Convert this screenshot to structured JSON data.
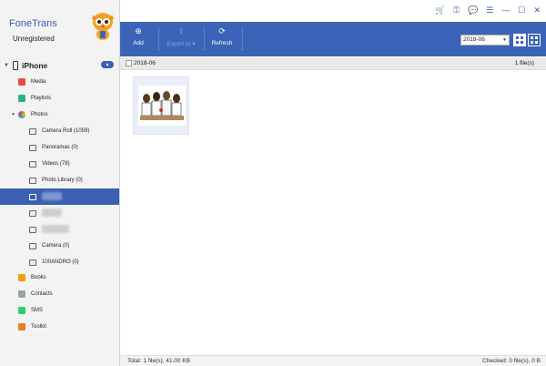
{
  "app": {
    "brand": "FoneTrans",
    "registration": "Unregistered"
  },
  "device": {
    "name": "iPhone"
  },
  "nav": {
    "media": "Media",
    "playlists": "Playlists",
    "photos": "Photos",
    "albums": [
      {
        "label": "Camera Roll (1059)"
      },
      {
        "label": "Panoramas (0)"
      },
      {
        "label": "Videos (78)"
      },
      {
        "label": "Photo Library (0)"
      },
      {
        "label": ""
      },
      {
        "label": ""
      },
      {
        "label": ""
      },
      {
        "label": "Camera (0)"
      },
      {
        "label": "100ANDRO (0)"
      }
    ],
    "books": "Books",
    "contacts": "Contacts",
    "sms": "SMS",
    "toolkit": "Toolkit"
  },
  "toolbar": {
    "add_label": "Add",
    "export_label": "Export to",
    "refresh_label": "Refresh",
    "month_value": "2018-06"
  },
  "group": {
    "date": "2018-06",
    "count": "1 file(s)"
  },
  "status": {
    "total": "Total: 1 file(s), 41.00 KB",
    "checked": "Checked: 0 file(s), 0 B"
  },
  "colors": {
    "accent": "#3b64b9",
    "selected": "#3b5fb3"
  }
}
